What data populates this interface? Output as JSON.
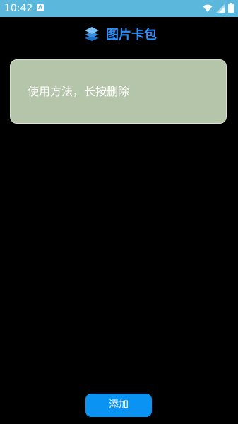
{
  "status_bar": {
    "time": "10:42",
    "notification_icon": "a-icon",
    "icons": [
      "wifi-icon",
      "signal-icon",
      "battery-icon"
    ]
  },
  "header": {
    "title": "图片卡包",
    "icon": "layers-icon"
  },
  "card": {
    "instruction": "使用方法，长按删除"
  },
  "footer": {
    "add_label": "添加"
  },
  "colors": {
    "status_bar": "#5bb8dc",
    "accent": "#2a8ff7",
    "card_bg": "#b5c5aa",
    "button_bg": "#0a93f2",
    "background": "#000000"
  }
}
